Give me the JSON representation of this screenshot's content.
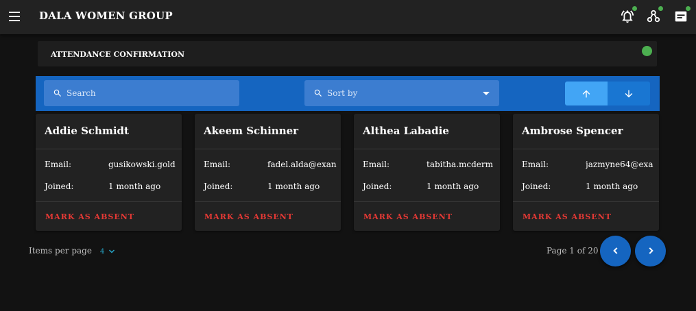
{
  "header": {
    "title": "DALA WOMEN GROUP",
    "icons": [
      "menu-icon",
      "notification-bell-icon",
      "groups-icon",
      "inbox-icon"
    ],
    "badge_color": "#4caf50"
  },
  "section": {
    "title": "ATTENDANCE CONFIRMATION",
    "status_color": "#4caf50"
  },
  "toolbar": {
    "search_placeholder": "Search",
    "sort_placeholder": "Sort by",
    "accent_color": "#1565c0"
  },
  "members": [
    {
      "name": "Addie Schmidt",
      "email": "gusikowski.gold",
      "joined": "1 month ago"
    },
    {
      "name": "Akeem Schinner",
      "email": "fadel.alda@exan",
      "joined": "1 month ago"
    },
    {
      "name": "Althea Labadie",
      "email": "tabitha.mcderm",
      "joined": "1 month ago"
    },
    {
      "name": "Ambrose Spencer",
      "email": "jazmyne64@exa",
      "joined": "1 month ago"
    }
  ],
  "card_labels": {
    "email": "Email:",
    "joined": "Joined:",
    "action": "MARK AS ABSENT"
  },
  "pagination": {
    "items_per_page_label": "Items per page",
    "items_per_page_value": "4",
    "page_info": "Page 1 of 20"
  }
}
